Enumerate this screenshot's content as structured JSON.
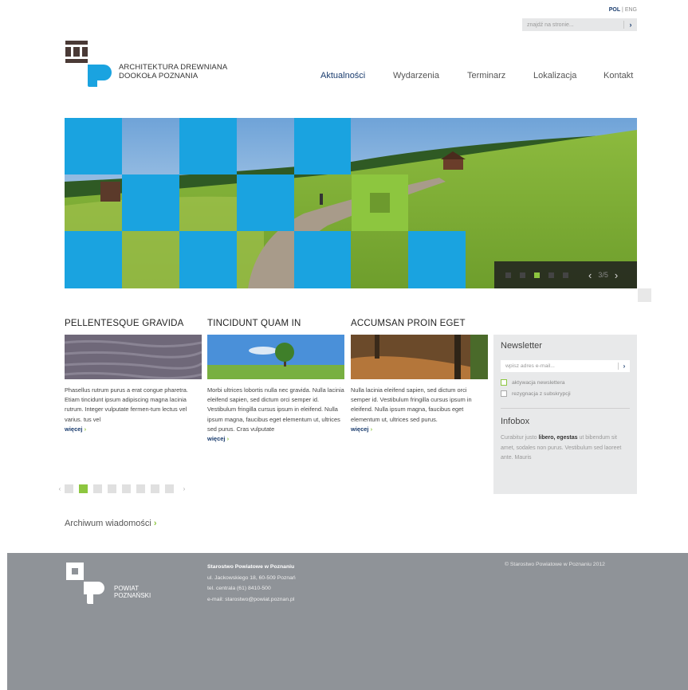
{
  "header": {
    "lang_active": "POL",
    "lang_sep": "|",
    "lang_other": "ENG",
    "search_placeholder": "znajdź na stronie...",
    "search_go": "›",
    "brand_line1": "ARCHITEKTURA DREWNIANA",
    "brand_line2": "DOOKOŁA POZNANIA"
  },
  "nav": [
    "Aktualności",
    "Wydarzenia",
    "Terminarz",
    "Lokalizacja",
    "Kontakt"
  ],
  "slider": {
    "counter": "3/5",
    "prev": "‹",
    "next": "›",
    "dots_total": 5,
    "dot_active": 3
  },
  "news": [
    {
      "title": "PELLENTESQUE GRAVIDA",
      "body": "Phasellus rutrum purus a erat congue pharetra. Etiam tincidunt ipsum adipiscing magna lacinia rutrum. Integer vulputate fermen-tum lectus vel varius. tus vel",
      "more": "więcej",
      "arrow": "›"
    },
    {
      "title": "TINCIDUNT QUAM IN",
      "body": "Morbi ultrices lobortis nulla nec gravida. Nulla lacinia eleifend sapien, sed dictum orci semper id. Vestibulum fringilla cursus ipsum in eleifend. Nulla ipsum magna, faucibus eget elementum ut, ultrices sed purus. Cras vulputate",
      "more": "więcej",
      "arrow": "›"
    },
    {
      "title": "ACCUMSAN PROIN EGET",
      "body": "Nulla lacinia eleifend sapien, sed dictum orci semper id. Vestibulum fringilla cursus ipsum in eleifend. Nulla ipsum magna, faucibus eget elementum ut, ultrices sed purus.",
      "more": "więcej",
      "arrow": "›"
    }
  ],
  "sidebar": {
    "newsletter_title": "Newsletter",
    "email_placeholder": "wpisz adres e-mail...",
    "email_go": "›",
    "opt_activate": "aktywacja newslettera",
    "opt_resign": "rezygnacja z subskrypcji",
    "infobox_title": "Infobox",
    "info_pre": "Curabitur justo ",
    "info_bold": "libero, egestas",
    "info_post": " ut bibendum sit amet, sodales non purus. Vestibulum sed laoreet ante. Mauris"
  },
  "pager": {
    "prev": "‹",
    "next": "›",
    "total": 8,
    "active": 2
  },
  "archive": {
    "label": "Archiwum wiadomości",
    "arrow": "›"
  },
  "footer": {
    "brand_line1": "POWIAT",
    "brand_line2": "POZNAŃSKI",
    "org": "Starostwo Powiatowe w Poznaniu",
    "addr": "ul. Jackowskiego 18, 60-509 Poznań",
    "tel": "tel. centrala (61) 8410-500",
    "email": "e-mail: starostwo@powiat.poznan.pl",
    "copyright": "© Starostwo Powiatowe w Poznaniu 2012"
  },
  "colors": {
    "accent_blue": "#1aa3e0",
    "accent_green": "#8dc63f",
    "navy": "#1a3c6e",
    "logo_brown": "#4a3a36",
    "footer_bg": "#8f9398"
  }
}
